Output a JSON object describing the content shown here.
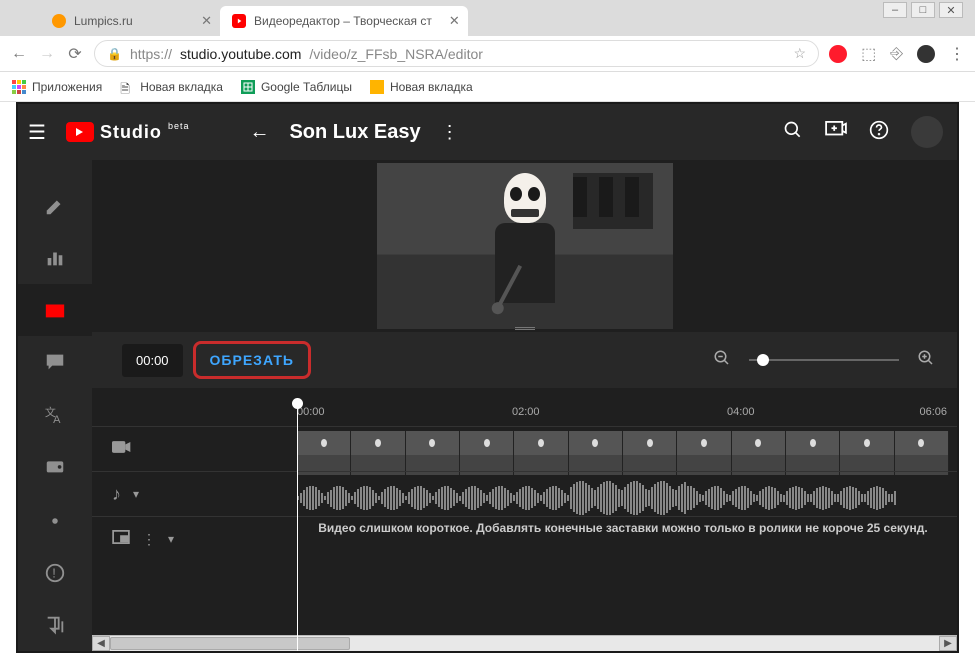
{
  "window": {
    "minimize": "–",
    "maximize": "□",
    "close": "✕"
  },
  "tabs": [
    {
      "title": "Lumpics.ru",
      "active": false
    },
    {
      "title": "Видеоредактор – Творческая ст",
      "active": true
    }
  ],
  "url": {
    "scheme": "https://",
    "host": "studio.youtube.com",
    "path": "/video/z_FFsb_NSRA/editor"
  },
  "bookmarks": {
    "apps": "Приложения",
    "items": [
      "Новая вкладка",
      "Google Таблицы",
      "Новая вкладка"
    ]
  },
  "app": {
    "brand": "Studio",
    "brand_suffix": "beta",
    "title": "Son Lux Easy",
    "time": "00:00",
    "trim": "ОБРЕЗАТЬ",
    "ruler": [
      "00:00",
      "02:00",
      "04:00",
      "06:06"
    ],
    "endscreen_msg": "Видео слишком короткое. Добавлять конечные заставки можно только в ролики не короче 25 секунд.",
    "sidebar": [
      "pencil",
      "analytics",
      "editor",
      "comments",
      "translate",
      "monetize",
      "settings",
      "alerts",
      "feedback"
    ],
    "track_labels": {
      "video": "video",
      "audio": "audio",
      "end": "end"
    }
  }
}
